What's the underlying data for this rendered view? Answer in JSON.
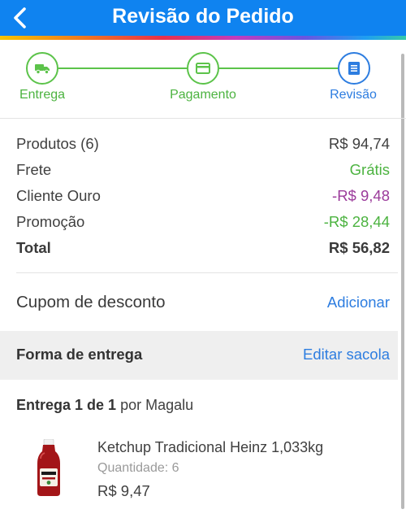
{
  "header": {
    "title": "Revisão do Pedido",
    "back_icon": "chevron-left-icon",
    "colors": {
      "background": "#0f83f0",
      "text": "#ffffff"
    }
  },
  "steps": [
    {
      "label": "Entrega",
      "icon": "truck-icon",
      "state": "done"
    },
    {
      "label": "Pagamento",
      "icon": "credit-card-icon",
      "state": "done"
    },
    {
      "label": "Revisão",
      "icon": "document-list-icon",
      "state": "active"
    }
  ],
  "summary": {
    "products_label": "Produtos (6)",
    "products_value": "R$ 94,74",
    "shipping_label": "Frete",
    "shipping_value": "Grátis",
    "gold_label": "Cliente Ouro",
    "gold_value": "-R$ 9,48",
    "promo_label": "Promoção",
    "promo_value": "-R$ 28,44",
    "total_label": "Total",
    "total_value": "R$ 56,82"
  },
  "coupon": {
    "label": "Cupom de desconto",
    "action": "Adicionar"
  },
  "delivery": {
    "title": "Forma de entrega",
    "action": "Editar sacola"
  },
  "shipment": {
    "prefix": "Entrega 1 de 1",
    "by": "por Magalu"
  },
  "product": {
    "name": "Ketchup Tradicional Heinz 1,033kg",
    "quantity": "Quantidade: 6",
    "price": "R$ 9,47"
  },
  "colors": {
    "accent": "#2d7de0",
    "success": "#4cb340",
    "loyalty": "#9b3b9b"
  }
}
